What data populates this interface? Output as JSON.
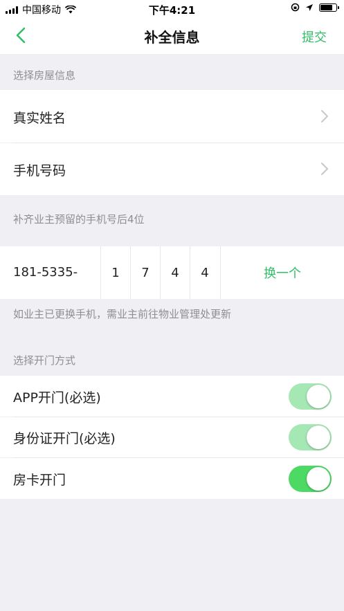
{
  "status_bar": {
    "carrier": "中国移动",
    "time": "下午4:21"
  },
  "nav": {
    "title": "补全信息",
    "submit_label": "提交"
  },
  "colors": {
    "accent": "#2fbf66",
    "toggle_on": "#4cd964",
    "toggle_disabled": "#a6e8b3"
  },
  "section_house": {
    "header": "选择房屋信息",
    "items": [
      {
        "label": "真实姓名"
      },
      {
        "label": "手机号码"
      }
    ]
  },
  "section_phone": {
    "header": "补齐业主预留的手机号后4位",
    "prefix": "181-5335-",
    "digits": [
      "1",
      "7",
      "4",
      "4"
    ],
    "change_label": "换一个",
    "note": "如业主已更换手机，需业主前往物业管理处更新"
  },
  "section_door": {
    "header": "选择开门方式",
    "items": [
      {
        "label": "APP开门(必选)",
        "enabled": true,
        "locked": true
      },
      {
        "label": "身份证开门(必选)",
        "enabled": true,
        "locked": true
      },
      {
        "label": "房卡开门",
        "enabled": true,
        "locked": false
      }
    ]
  }
}
